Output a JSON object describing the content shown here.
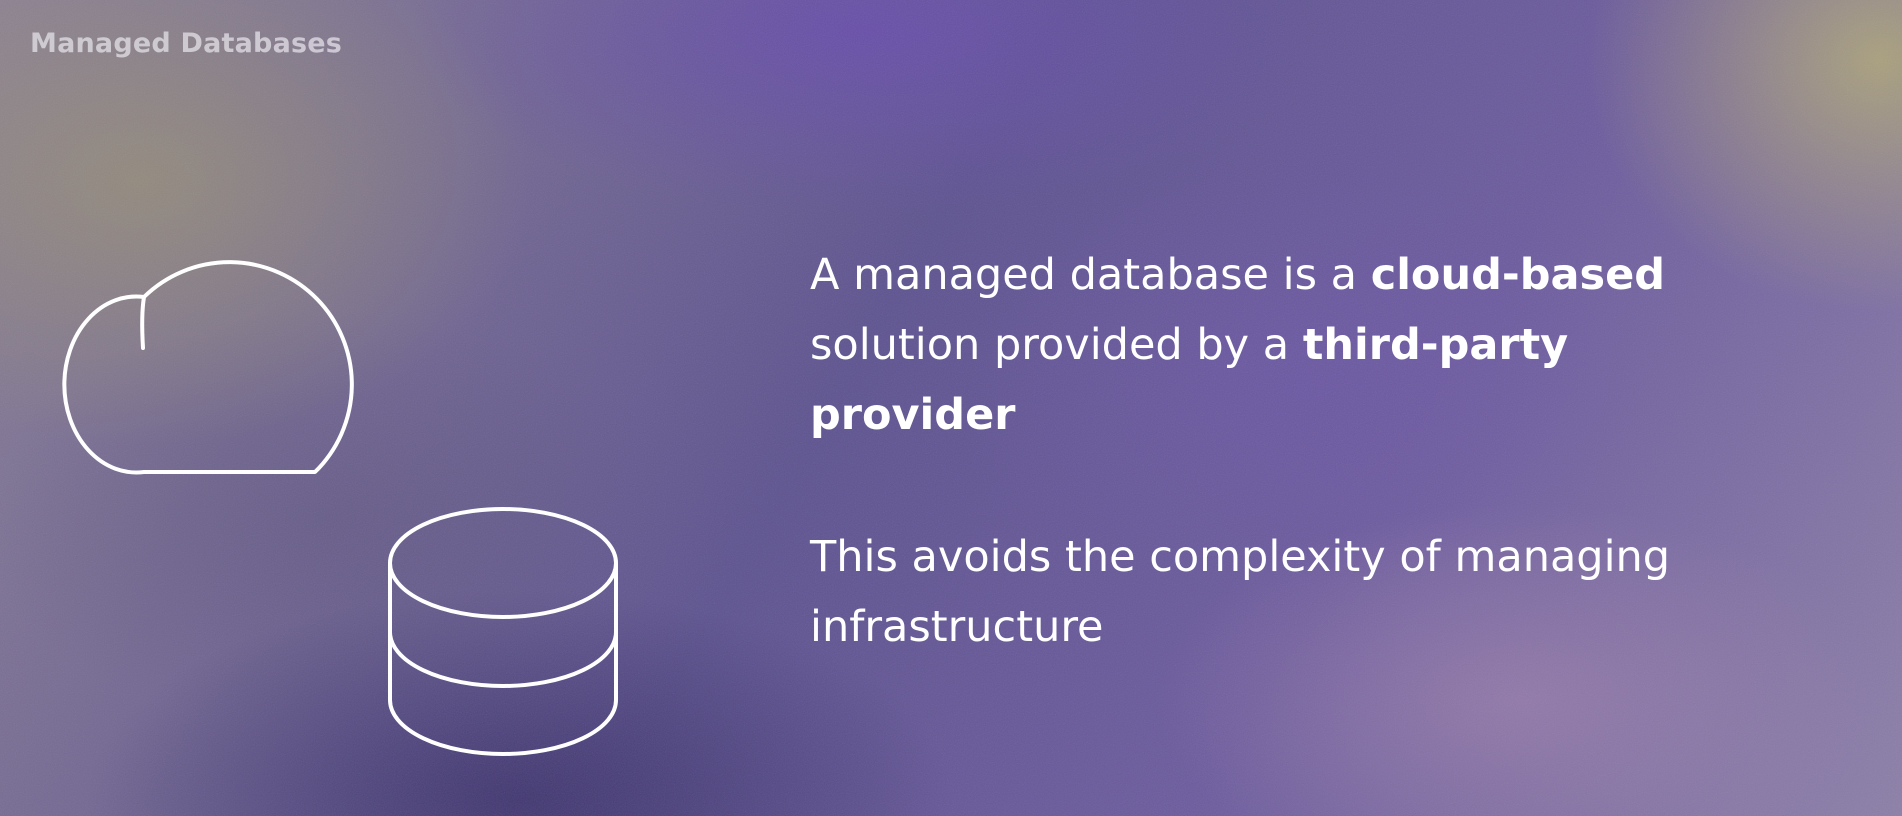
{
  "header": {
    "title": "Managed Databases"
  },
  "paragraph1": {
    "part1": "A managed database is a ",
    "bold1": "cloud-based",
    "part2": " solution provided by a ",
    "bold2": "third-party provider"
  },
  "paragraph2": {
    "text": "This avoids the complexity of managing infrastructure"
  },
  "icons": {
    "cloud": "cloud-icon",
    "database": "database-icon"
  },
  "colors": {
    "text": "#ffffff",
    "icon_stroke": "#ffffff",
    "header_text": "#e8e4ec"
  }
}
